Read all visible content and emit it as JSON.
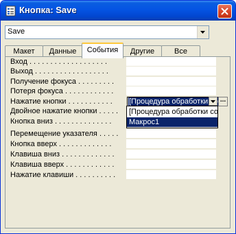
{
  "window": {
    "title": "Кнопка: Save",
    "close_symbol": "✕",
    "icon": "property-sheet-icon"
  },
  "object_selector": {
    "value": "Save"
  },
  "tabs": [
    {
      "label": "Макет",
      "active": false
    },
    {
      "label": "Данные",
      "active": false
    },
    {
      "label": "События",
      "active": true
    },
    {
      "label": "Другие",
      "active": false
    },
    {
      "label": "Все",
      "active": false
    }
  ],
  "properties": [
    {
      "label": "Вход . . . . . . . . . . . . . . . . . . .",
      "value": ""
    },
    {
      "label": "Выход . . . . . . . . . . . . . . . . . .",
      "value": ""
    },
    {
      "label": "Получение фокуса . . . . . . . . .",
      "value": ""
    },
    {
      "label": "Потеря фокуса . . . . . . . . . . . .",
      "value": ""
    },
    {
      "label": "Нажатие кнопки . . . . . . . . . . .",
      "value": "[Процедура обработки событий]"
    },
    {
      "label": "Двойное нажатие кнопки . . . . .",
      "value": ""
    },
    {
      "label": "Кнопка вниз . . . . . . . . . . . . . .",
      "value": ""
    },
    {
      "label": "Перемещение указателя . . . . .",
      "value": ""
    },
    {
      "label": "Кнопка вверх . . . . . . . . . . . . .",
      "value": ""
    },
    {
      "label": "Клавиша вниз . . . . . . . . . . . . .",
      "value": ""
    },
    {
      "label": "Клавиша вверх . . . . . . . . . . . .",
      "value": ""
    },
    {
      "label": "Нажатие клавиши . . . . . . . . . .",
      "value": ""
    }
  ],
  "active_combo": {
    "value": "[Процедура обработки событий]",
    "builder_label": "..."
  },
  "dropdown": {
    "options": [
      "[Процедура обработки событий]",
      "Макрос1"
    ],
    "selected_index": 1
  },
  "colors": {
    "titlebar": "#0554e3",
    "selection": "#0a246a",
    "active_tab_accent": "#ffc83c",
    "panel": "#ece9d8"
  }
}
